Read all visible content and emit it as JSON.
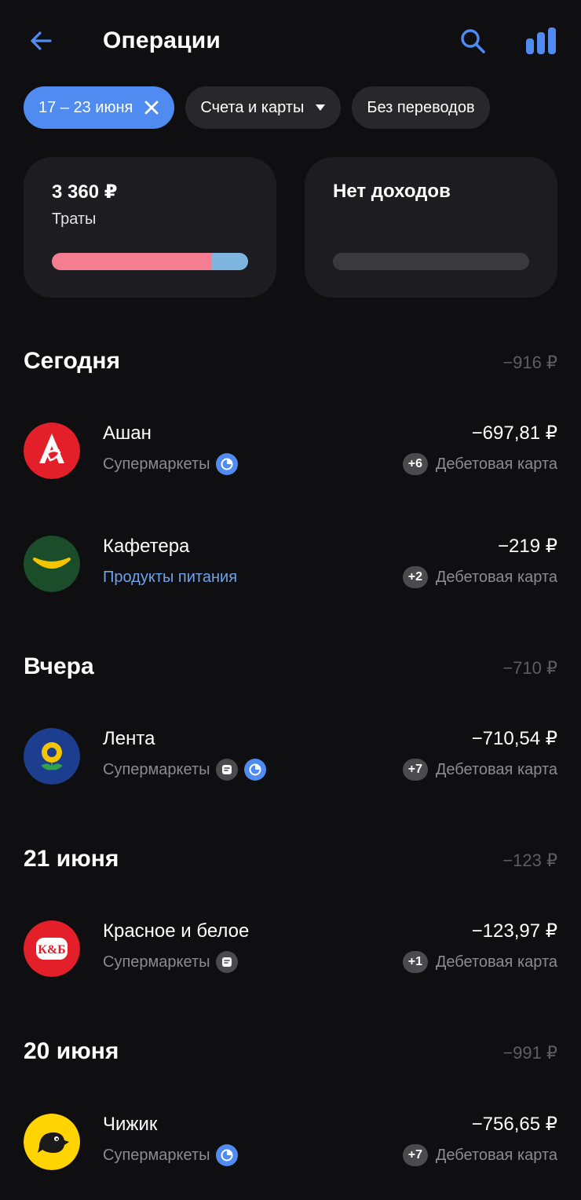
{
  "header": {
    "title": "Операции",
    "back_icon": "arrow-left-icon",
    "search_icon": "search-icon",
    "stats_icon": "bar-chart-icon"
  },
  "filters": {
    "period": "17 – 23 июня",
    "accounts": "Счета и карты",
    "transfers": "Без переводов"
  },
  "summary": {
    "expenses": {
      "amount": "3 360 ₽",
      "label": "Траты",
      "bar_fraction_primary": 0.81,
      "bar_color_primary": "#f47d8f",
      "bar_color_secondary": "#7fb6df"
    },
    "income": {
      "label": "Нет доходов"
    }
  },
  "colors": {
    "accent": "#4f8bf0",
    "background": "#0f0f11",
    "card": "#1d1d21"
  },
  "sections": [
    {
      "title": "Сегодня",
      "total": "−916 ₽",
      "items": [
        {
          "merchant": "Ашан",
          "category": "Супермаркеты",
          "price": "−697,81 ₽",
          "extra": "+6",
          "account": "Дебетовая карта"
        },
        {
          "merchant": "Кафетера",
          "category": "Продукты питания",
          "price": "−219 ₽",
          "extra": "+2",
          "account": "Дебетовая карта"
        }
      ]
    },
    {
      "title": "Вчера",
      "total": "−710 ₽",
      "items": [
        {
          "merchant": "Лента",
          "category": "Супермаркеты",
          "price": "−710,54 ₽",
          "extra": "+7",
          "account": "Дебетовая карта"
        }
      ]
    },
    {
      "title": "21 июня",
      "total": "−123 ₽",
      "items": [
        {
          "merchant": "Красное и белое",
          "category": "Супермаркеты",
          "price": "−123,97 ₽",
          "extra": "+1",
          "account": "Дебетовая карта",
          "logo_text": "К&Б"
        }
      ]
    },
    {
      "title": "20 июня",
      "total": "−991 ₽",
      "items": [
        {
          "merchant": "Чижик",
          "category": "Супермаркеты",
          "price": "−756,65 ₽",
          "extra": "+7",
          "account": "Дебетовая карта"
        }
      ]
    }
  ]
}
